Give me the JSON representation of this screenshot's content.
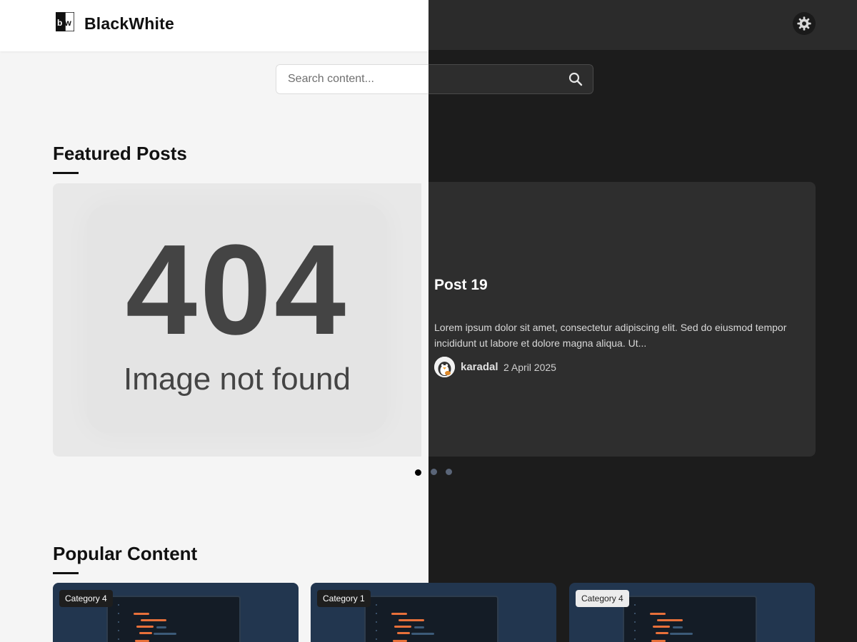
{
  "colors": {
    "light_bg": "#f5f5f5",
    "dark_bg": "#1c1c1c",
    "card_dark": "#2e2e2e",
    "thumb_bg": "#22364f",
    "code_accent": "#e8703a"
  },
  "header": {
    "brand": "BlackWhite",
    "logo_text": "bw",
    "theme_toggle_icon": "gear-icon"
  },
  "search": {
    "placeholder": "Search content...",
    "icon": "search-icon"
  },
  "featured": {
    "section_title": "Featured Posts",
    "image": {
      "code": "404",
      "message": "Image not found"
    },
    "post": {
      "title": "Post 19",
      "excerpt": "Lorem ipsum dolor sit amet, consectetur adipiscing elit. Sed do eiusmod tempor incididunt ut labore et dolore magna aliqua. Ut...",
      "author": "karadal",
      "date": "2 April 2025"
    },
    "carousel": {
      "slide_count": 3,
      "active_index": 0
    }
  },
  "popular": {
    "section_title": "Popular Content",
    "cards": [
      {
        "category": "Category 4"
      },
      {
        "category": "Category 1"
      },
      {
        "category": "Category 4"
      }
    ]
  }
}
